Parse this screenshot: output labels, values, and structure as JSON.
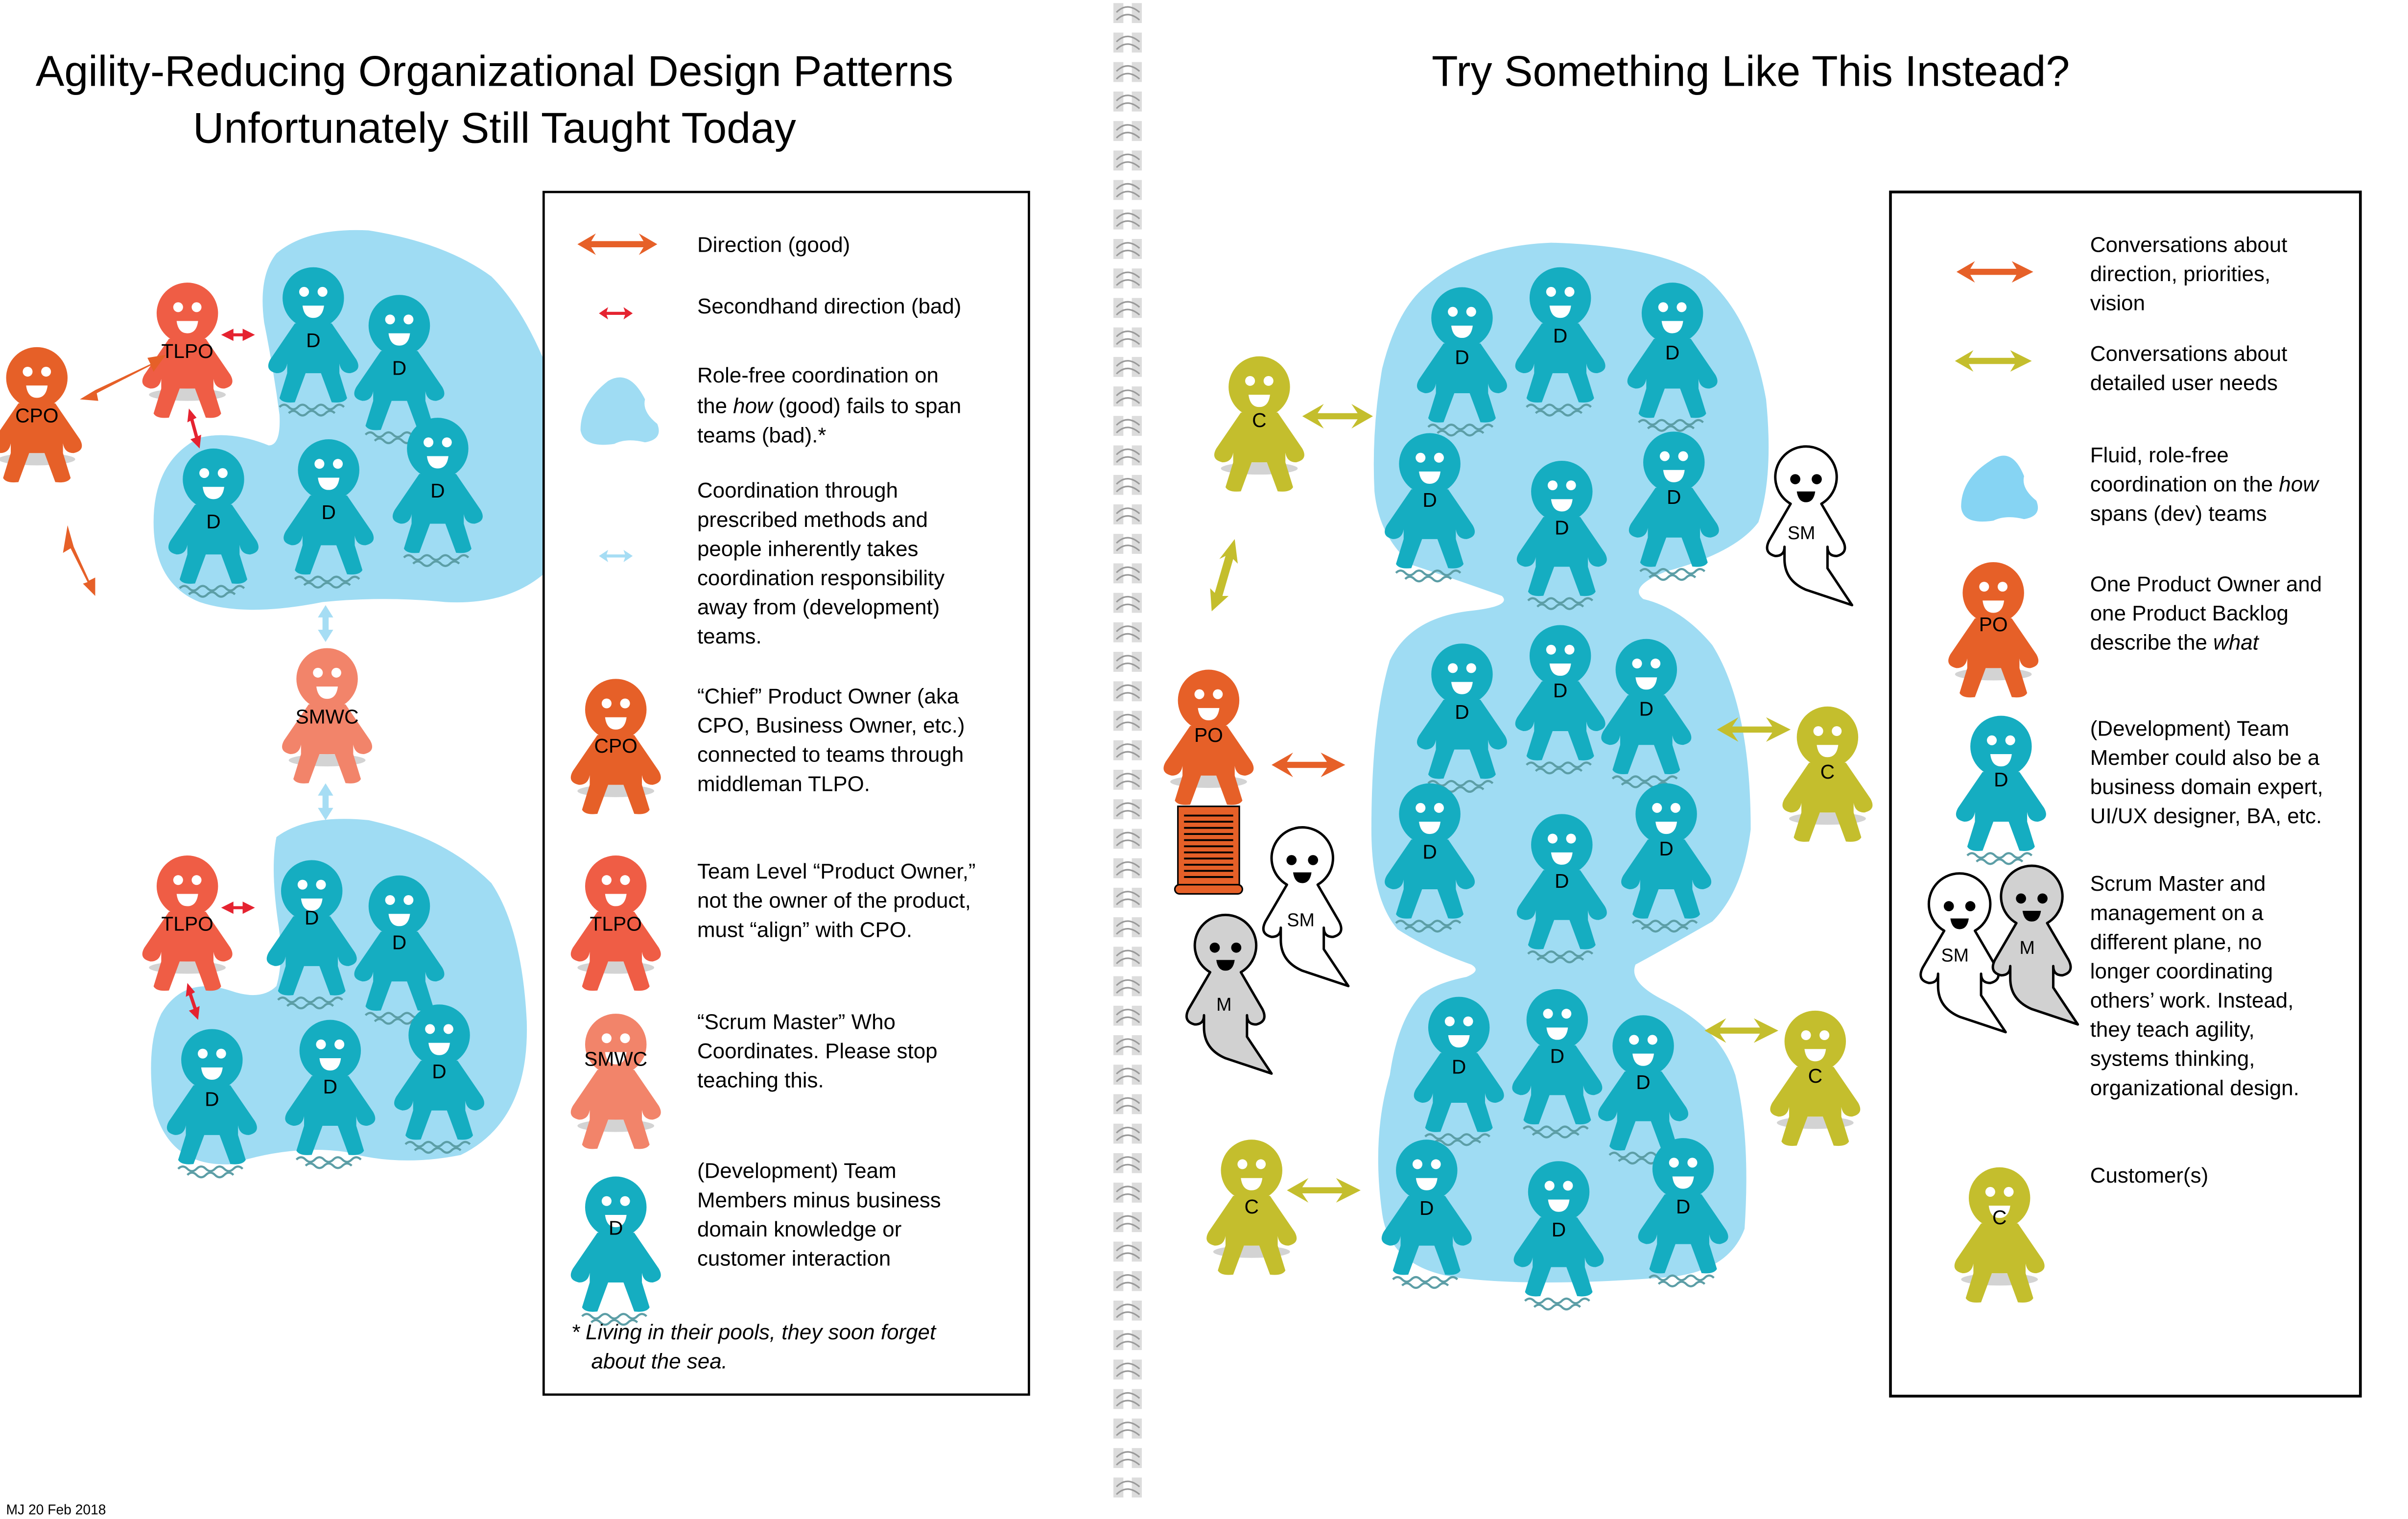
{
  "left": {
    "title_line1": "Agility-Reducing Organizational Design Patterns",
    "title_line2": "Unfortunately Still Taught Today",
    "figures": {
      "cpo": "CPO",
      "tlpo_top": "TLPO",
      "tlpo_bottom": "TLPO",
      "smwc": "SMWC",
      "dev": "D"
    },
    "legend": [
      {
        "icon": "orange-double-arrow-icon",
        "lines": [
          "Direction (good)"
        ]
      },
      {
        "icon": "red-small-double-arrow-icon",
        "lines": [
          "Secondhand direction (bad)"
        ]
      },
      {
        "icon": "blue-pool-icon",
        "lines": [
          "Role-free coordination on",
          "the how (good) fails to span",
          "teams (bad).*"
        ]
      },
      {
        "icon": "light-blue-double-arrow-icon",
        "lines": [
          "Coordination through",
          "prescribed methods and",
          "people inherently takes",
          "coordination responsibility",
          "away from (development)",
          "teams."
        ]
      },
      {
        "icon": "cpo-figure-icon",
        "label": "CPO",
        "lines": [
          "“Chief” Product Owner (aka",
          "CPO, Business Owner, etc.)",
          "connected to teams through",
          "middleman TLPO."
        ]
      },
      {
        "icon": "tlpo-figure-icon",
        "label": "TLPO",
        "lines": [
          "Team Level “Product Owner,”",
          "not the owner of the product,",
          "must “align” with CPO."
        ]
      },
      {
        "icon": "smwc-figure-icon",
        "label": "SMWC",
        "lines": [
          "“Scrum Master” Who",
          "Coordinates. Please stop",
          "teaching this."
        ]
      },
      {
        "icon": "dev-figure-icon",
        "label": "D",
        "lines": [
          "(Development) Team",
          "Members minus business",
          "domain knowledge or",
          "customer interaction"
        ]
      }
    ],
    "footnote_line1": "*  Living in their pools, they soon forget",
    "footnote_line2": "about the sea."
  },
  "right": {
    "title": "Try Something Like This Instead?",
    "figures": {
      "po": "PO",
      "customer": "C",
      "dev": "D",
      "sm": "SM",
      "m": "M"
    },
    "legend": [
      {
        "icon": "orange-double-arrow-icon",
        "lines": [
          "Conversations about",
          "direction, priorities,",
          "vision"
        ]
      },
      {
        "icon": "olive-double-arrow-icon",
        "lines": [
          "Conversations about",
          "detailed user needs"
        ]
      },
      {
        "icon": "blue-pool-icon",
        "lines": [
          "Fluid, role-free",
          "coordination on the how",
          "spans (dev) teams"
        ]
      },
      {
        "icon": "po-figure-icon",
        "label": "PO",
        "lines": [
          "One Product Owner and",
          "one Product Backlog",
          "describe the what"
        ]
      },
      {
        "icon": "dev-figure-icon",
        "label": "D",
        "lines": [
          "(Development) Team",
          "Member could also be a",
          "business domain expert,",
          "UI/UX designer, BA, etc."
        ]
      },
      {
        "icon": "ghosts-icon",
        "labels": [
          "SM",
          "M"
        ],
        "lines": [
          "Scrum Master and",
          "management on a",
          "different plane, no",
          "longer coordinating",
          "others’ work. Instead,",
          "they teach agility,",
          "systems thinking,",
          "organizational design."
        ]
      },
      {
        "icon": "customer-figure-icon",
        "label": "C",
        "lines": [
          "Customer(s)"
        ]
      }
    ]
  },
  "footer": "MJ 20 Feb 2018",
  "colors": {
    "cpo": "#E66028",
    "tlpo": "#EF5D45",
    "smwc": "#F2846A",
    "dev": "#15ADC1",
    "customer": "#C4BE2D",
    "pool": "#9FDCF3",
    "red_arrow": "#E52330",
    "light_blue_arrow": "#A6DDF4",
    "ghost_grey": "#D1D1D1",
    "backlog": "#E66028"
  }
}
